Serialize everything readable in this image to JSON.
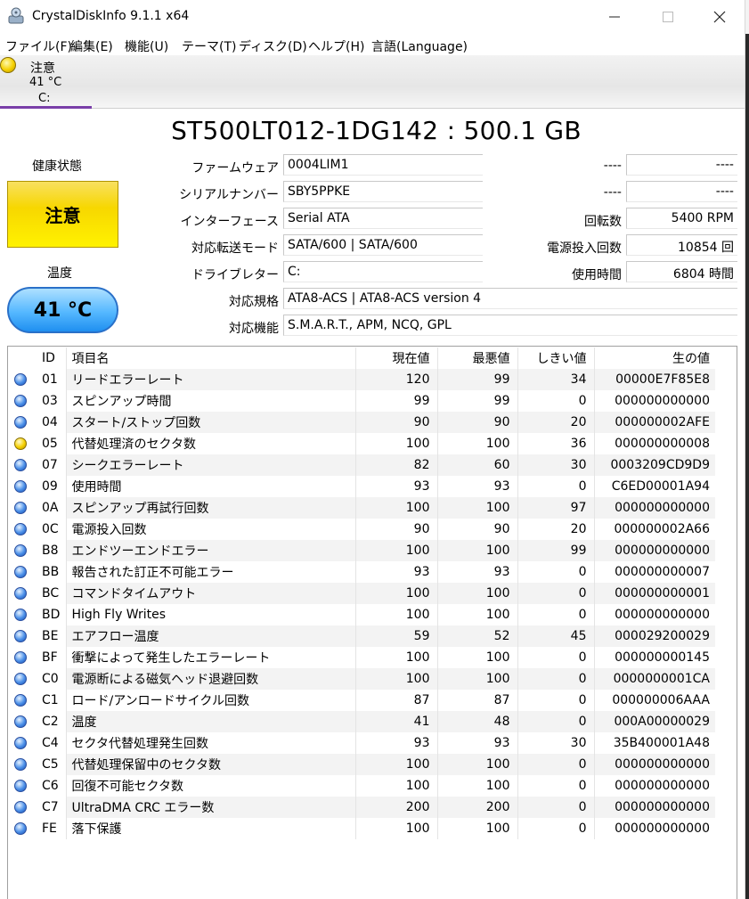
{
  "window": {
    "title": "CrystalDiskInfo 9.1.1 x64",
    "icon": "crystaldiskinfo-icon",
    "minimize_icon": "minimize-icon",
    "maximize_icon": "maximize-icon",
    "close_icon": "close-icon"
  },
  "menu": [
    "ファイル(F)",
    "編集(E)",
    "機能(U)",
    "テーマ(T)",
    "ディスク(D)",
    "ヘルプ(H)",
    "言語(Language)"
  ],
  "disk_tab": {
    "status": "注意",
    "temperature": "41 °C",
    "drive_letter": "C:",
    "status_color": "#f5d000"
  },
  "model": "ST500LT012-1DG142 : 500.1 GB",
  "health": {
    "label": "健康状態",
    "value": "注意",
    "color": "#f7d700"
  },
  "temperature": {
    "label": "温度",
    "value": "41 °C",
    "color": "#55b8ff"
  },
  "info": {
    "firmware": {
      "label": "ファームウェア",
      "value": "0004LIM1"
    },
    "serial": {
      "label": "シリアルナンバー",
      "value": "SBY5PPKE"
    },
    "interface": {
      "label": "インターフェース",
      "value": "Serial ATA"
    },
    "transfer_mode": {
      "label": "対応転送モード",
      "value": "SATA/600 | SATA/600"
    },
    "drive_letter": {
      "label": "ドライブレター",
      "value": "C:"
    },
    "standard": {
      "label": "対応規格",
      "value": "ATA8-ACS | ATA8-ACS version 4"
    },
    "features": {
      "label": "対応機能",
      "value": "S.M.A.R.T., APM, NCQ, GPL"
    },
    "right1": {
      "label": "----",
      "value": "----"
    },
    "right2": {
      "label": "----",
      "value": "----"
    },
    "rotation": {
      "label": "回転数",
      "value": "5400 RPM"
    },
    "power_on_count": {
      "label": "電源投入回数",
      "value": "10854 回"
    },
    "power_on_hours": {
      "label": "使用時間",
      "value": "6804 時間"
    }
  },
  "smart": {
    "headers": [
      "ID",
      "項目名",
      "現在値",
      "最悪値",
      "しきい値",
      "生の値"
    ],
    "status_colors": {
      "good": "#4a8fe8",
      "caution": "#f5d000"
    },
    "rows": [
      {
        "status": "good",
        "id": "01",
        "name": "リードエラーレート",
        "current": "120",
        "worst": "99",
        "threshold": "34",
        "raw": "00000E7F85E8"
      },
      {
        "status": "good",
        "id": "03",
        "name": "スピンアップ時間",
        "current": "99",
        "worst": "99",
        "threshold": "0",
        "raw": "000000000000"
      },
      {
        "status": "good",
        "id": "04",
        "name": "スタート/ストップ回数",
        "current": "90",
        "worst": "90",
        "threshold": "20",
        "raw": "000000002AFE"
      },
      {
        "status": "caution",
        "id": "05",
        "name": "代替処理済のセクタ数",
        "current": "100",
        "worst": "100",
        "threshold": "36",
        "raw": "000000000008"
      },
      {
        "status": "good",
        "id": "07",
        "name": "シークエラーレート",
        "current": "82",
        "worst": "60",
        "threshold": "30",
        "raw": "0003209CD9D9"
      },
      {
        "status": "good",
        "id": "09",
        "name": "使用時間",
        "current": "93",
        "worst": "93",
        "threshold": "0",
        "raw": "C6ED00001A94"
      },
      {
        "status": "good",
        "id": "0A",
        "name": "スピンアップ再試行回数",
        "current": "100",
        "worst": "100",
        "threshold": "97",
        "raw": "000000000000"
      },
      {
        "status": "good",
        "id": "0C",
        "name": "電源投入回数",
        "current": "90",
        "worst": "90",
        "threshold": "20",
        "raw": "000000002A66"
      },
      {
        "status": "good",
        "id": "B8",
        "name": "エンドツーエンドエラー",
        "current": "100",
        "worst": "100",
        "threshold": "99",
        "raw": "000000000000"
      },
      {
        "status": "good",
        "id": "BB",
        "name": "報告された訂正不可能エラー",
        "current": "93",
        "worst": "93",
        "threshold": "0",
        "raw": "000000000007"
      },
      {
        "status": "good",
        "id": "BC",
        "name": "コマンドタイムアウト",
        "current": "100",
        "worst": "100",
        "threshold": "0",
        "raw": "000000000001"
      },
      {
        "status": "good",
        "id": "BD",
        "name": "High Fly Writes",
        "current": "100",
        "worst": "100",
        "threshold": "0",
        "raw": "000000000000"
      },
      {
        "status": "good",
        "id": "BE",
        "name": "エアフロー温度",
        "current": "59",
        "worst": "52",
        "threshold": "45",
        "raw": "000029200029"
      },
      {
        "status": "good",
        "id": "BF",
        "name": "衝撃によって発生したエラーレート",
        "current": "100",
        "worst": "100",
        "threshold": "0",
        "raw": "000000000145"
      },
      {
        "status": "good",
        "id": "C0",
        "name": "電源断による磁気ヘッド退避回数",
        "current": "100",
        "worst": "100",
        "threshold": "0",
        "raw": "0000000001CA"
      },
      {
        "status": "good",
        "id": "C1",
        "name": "ロード/アンロードサイクル回数",
        "current": "87",
        "worst": "87",
        "threshold": "0",
        "raw": "000000006AAA"
      },
      {
        "status": "good",
        "id": "C2",
        "name": "温度",
        "current": "41",
        "worst": "48",
        "threshold": "0",
        "raw": "000A00000029"
      },
      {
        "status": "good",
        "id": "C4",
        "name": "セクタ代替処理発生回数",
        "current": "93",
        "worst": "93",
        "threshold": "30",
        "raw": "35B400001A48"
      },
      {
        "status": "good",
        "id": "C5",
        "name": "代替処理保留中のセクタ数",
        "current": "100",
        "worst": "100",
        "threshold": "0",
        "raw": "000000000000"
      },
      {
        "status": "good",
        "id": "C6",
        "name": "回復不可能セクタ数",
        "current": "100",
        "worst": "100",
        "threshold": "0",
        "raw": "000000000000"
      },
      {
        "status": "good",
        "id": "C7",
        "name": "UltraDMA CRC エラー数",
        "current": "200",
        "worst": "200",
        "threshold": "0",
        "raw": "000000000000"
      },
      {
        "status": "good",
        "id": "FE",
        "name": "落下保護",
        "current": "100",
        "worst": "100",
        "threshold": "0",
        "raw": "000000000000"
      }
    ]
  }
}
